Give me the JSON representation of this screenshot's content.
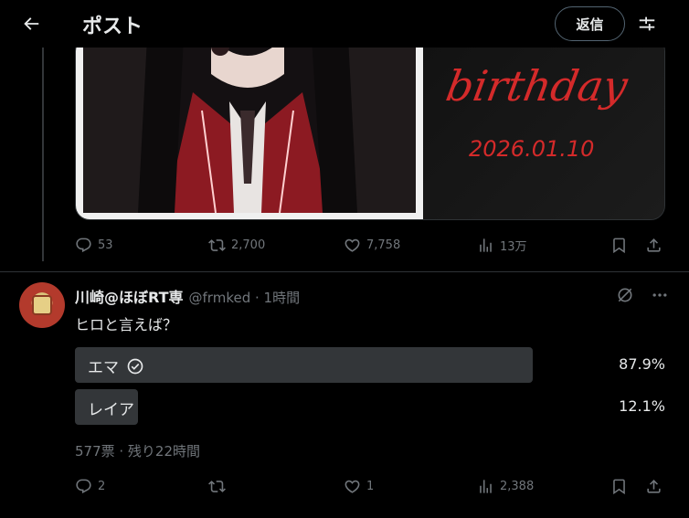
{
  "header": {
    "title": "ポスト",
    "reply_label": "返信"
  },
  "media": {
    "birthday_text": "birthday",
    "date_text": "2026.01.10"
  },
  "post_actions": {
    "replies": "53",
    "reposts": "2,700",
    "likes": "7,758",
    "views": "13万"
  },
  "reply": {
    "author_name": "川崎@ほぼRT専",
    "meta": "@frmked · 1時間",
    "text": "ヒロと言えば？",
    "poll": {
      "options": [
        {
          "label": "エマ",
          "percent": "87.9%",
          "share": 0.879,
          "selected": true
        },
        {
          "label": "レイア",
          "percent": "12.1%",
          "share": 0.121,
          "selected": false
        }
      ],
      "meta": "577票 · 残り22時間"
    },
    "actions": {
      "replies": "2",
      "reposts": "",
      "likes": "1",
      "views": "2,388"
    }
  },
  "colors": {
    "background": "#000000",
    "text": "#e7e9ea",
    "muted": "#71767b",
    "poll_bar": "#333639",
    "accent_red": "#d42a2a"
  },
  "icons": [
    "back-arrow-icon",
    "adjust-icon",
    "reply-icon",
    "repost-icon",
    "like-icon",
    "views-icon",
    "bookmark-icon",
    "share-icon",
    "grok-icon",
    "more-icon",
    "check-circle-icon"
  ]
}
